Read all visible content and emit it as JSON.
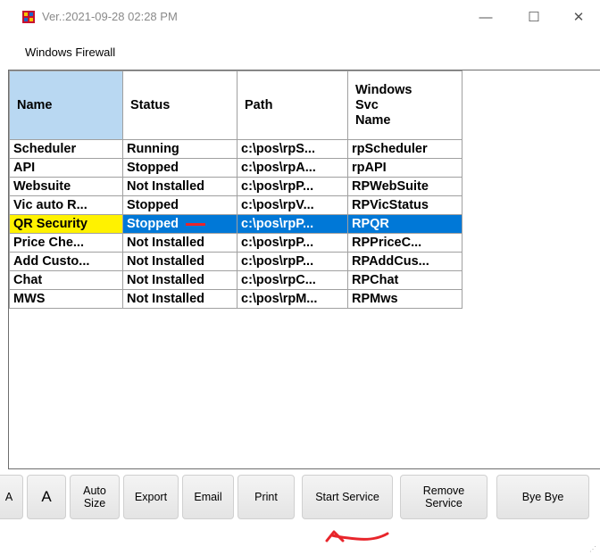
{
  "window": {
    "title": "Ver.:2021-09-28 02:28 PM",
    "minimize_glyph": "—",
    "maximize_glyph": "☐",
    "close_glyph": "✕"
  },
  "section_label": "Windows Firewall",
  "grid": {
    "headers": [
      "Name",
      "Status",
      "Path",
      "Windows\nSvc\nName"
    ],
    "rows": [
      {
        "name": "Scheduler",
        "status": "Running",
        "path": "c:\\pos\\rpS...",
        "svc": "rpScheduler"
      },
      {
        "name": "API",
        "status": "Stopped",
        "path": "c:\\pos\\rpA...",
        "svc": "rpAPI"
      },
      {
        "name": "Websuite",
        "status": "Not Installed",
        "path": "c:\\pos\\rpP...",
        "svc": "RPWebSuite"
      },
      {
        "name": "Vic auto R...",
        "status": "Stopped",
        "path": "c:\\pos\\rpV...",
        "svc": "RPVicStatus"
      },
      {
        "name": "QR Security",
        "status": "Stopped",
        "path": "c:\\pos\\rpP...",
        "svc": "RPQR"
      },
      {
        "name": "Price Che...",
        "status": "Not Installed",
        "path": "c:\\pos\\rpP...",
        "svc": "RPPriceC..."
      },
      {
        "name": "Add Custo...",
        "status": "Not Installed",
        "path": "c:\\pos\\rpP...",
        "svc": "RPAddCus..."
      },
      {
        "name": "Chat",
        "status": "Not Installed",
        "path": "c:\\pos\\rpC...",
        "svc": "RPChat"
      },
      {
        "name": "MWS",
        "status": "Not Installed",
        "path": "c:\\pos\\rpM...",
        "svc": "RPMws"
      }
    ]
  },
  "toolbar": {
    "font_small": "A",
    "font_large": "A",
    "auto_size": "Auto\nSize",
    "export": "Export",
    "email": "Email",
    "print": "Print",
    "start_service": "Start Service",
    "remove_service": "Remove\nService",
    "bye_bye": "Bye Bye"
  },
  "colors": {
    "selection": "#0078d7",
    "highlight": "#fff200",
    "header_selected": "#b9d8f2",
    "annotation": "#e8252b"
  }
}
